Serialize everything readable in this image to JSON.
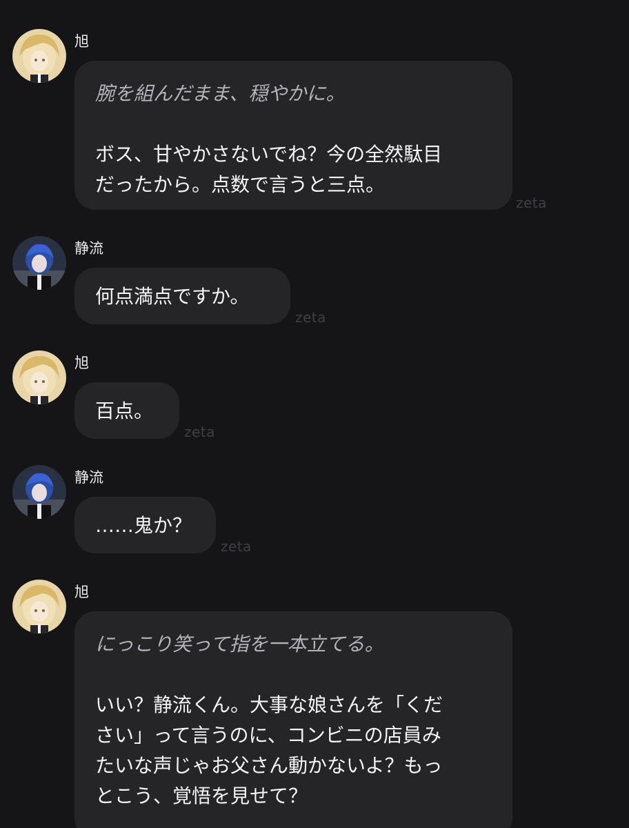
{
  "colors": {
    "background": "#151517",
    "bubble": "#252528",
    "action_text": "#b3b3b8",
    "text": "#f4f4f6",
    "watermark": "#3f3f44"
  },
  "messages": [
    {
      "speaker": "旭",
      "avatar": "blonde-boy-avatar",
      "action": "腕を組んだまま、穏やかに。",
      "lines": [
        "ボス、甘やかさないでね？今の全然駄目",
        "だったから。点数で言うと三点。"
      ],
      "watermark": "zeta"
    },
    {
      "speaker": "静流",
      "avatar": "blue-hair-boy-avatar",
      "lines": [
        "何点満点ですか。"
      ],
      "watermark": "zeta"
    },
    {
      "speaker": "旭",
      "avatar": "blonde-boy-avatar",
      "lines": [
        "百点。"
      ],
      "watermark": "zeta"
    },
    {
      "speaker": "静流",
      "avatar": "blue-hair-boy-avatar",
      "lines": [
        "……鬼か？"
      ],
      "watermark": "zeta"
    },
    {
      "speaker": "旭",
      "avatar": "blonde-boy-avatar",
      "action": "にっこり笑って指を一本立てる。",
      "lines": [
        "いい？静流くん。大事な娘さんを「くだ",
        "さい」って言うのに、コンビニの店員み",
        "たいな声じゃお父さん動かないよ？もっ",
        "とこう、覚悟を見せて？"
      ]
    }
  ]
}
